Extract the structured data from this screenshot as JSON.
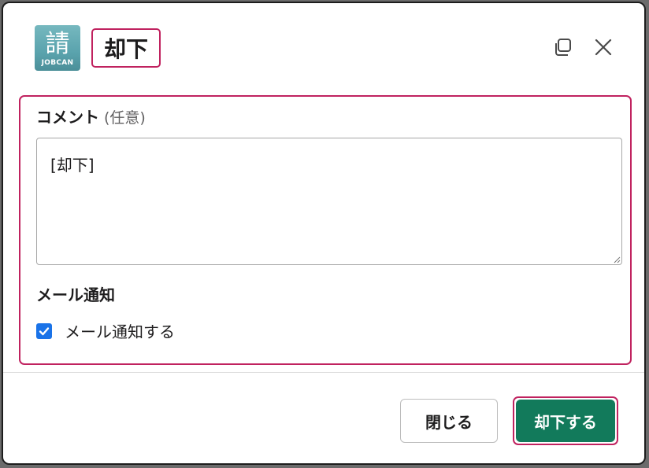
{
  "header": {
    "app_icon": {
      "glyph": "請",
      "brand": "JOBCAN"
    },
    "title": "却下",
    "copy_icon": "copy-icon",
    "close_icon": "close-icon"
  },
  "form": {
    "comment_label": "コメント",
    "comment_optional": "(任意)",
    "comment_value": "[却下]",
    "mail_heading": "メール通知",
    "mail_checkbox_label": "メール通知する",
    "mail_checked": true
  },
  "footer": {
    "close_label": "閉じる",
    "reject_label": "却下する"
  },
  "colors": {
    "accent_highlight": "#c0225f",
    "primary_button": "#127a5b",
    "checkbox": "#1a73e8"
  }
}
